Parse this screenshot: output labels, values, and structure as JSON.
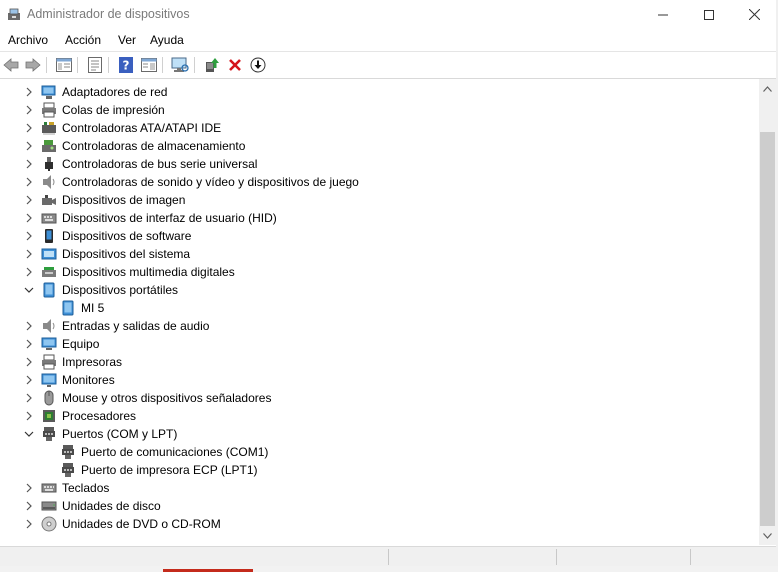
{
  "window": {
    "title": "Administrador de dispositivos"
  },
  "menu": [
    "Archivo",
    "Acción",
    "Ver",
    "Ayuda"
  ],
  "toolbar_icons": [
    "back-arrow-icon",
    "forward-arrow-icon",
    "show-hide-tree-icon",
    "properties-icon",
    "help-icon",
    "action-pane-icon",
    "scan-hardware-icon",
    "update-driver-icon",
    "uninstall-icon",
    "disable-icon"
  ],
  "tree": [
    {
      "label": "Adaptadores de red",
      "expanded": false,
      "icon": "network-adapter-icon"
    },
    {
      "label": "Colas de impresión",
      "expanded": false,
      "icon": "print-queue-icon"
    },
    {
      "label": "Controladoras ATA/ATAPI IDE",
      "expanded": false,
      "icon": "ide-controller-icon"
    },
    {
      "label": "Controladoras de almacenamiento",
      "expanded": false,
      "icon": "storage-controller-icon"
    },
    {
      "label": "Controladoras de bus serie universal",
      "expanded": false,
      "icon": "usb-icon"
    },
    {
      "label": "Controladoras de sonido y vídeo y dispositivos de juego",
      "expanded": false,
      "icon": "speaker-icon"
    },
    {
      "label": "Dispositivos de imagen",
      "expanded": false,
      "icon": "camera-icon"
    },
    {
      "label": "Dispositivos de interfaz de usuario (HID)",
      "expanded": false,
      "icon": "hid-keyboard-icon"
    },
    {
      "label": "Dispositivos de software",
      "expanded": false,
      "icon": "software-device-icon"
    },
    {
      "label": "Dispositivos del sistema",
      "expanded": false,
      "icon": "system-device-icon"
    },
    {
      "label": "Dispositivos multimedia digitales",
      "expanded": false,
      "icon": "multimedia-device-icon"
    },
    {
      "label": "Dispositivos portátiles",
      "expanded": true,
      "icon": "portable-device-icon",
      "children": [
        {
          "label": "MI 5",
          "icon": "phone-icon"
        }
      ]
    },
    {
      "label": "Entradas y salidas de audio",
      "expanded": false,
      "icon": "audio-io-icon"
    },
    {
      "label": "Equipo",
      "expanded": false,
      "icon": "computer-icon"
    },
    {
      "label": "Impresoras",
      "expanded": false,
      "icon": "printer-icon"
    },
    {
      "label": "Monitores",
      "expanded": false,
      "icon": "monitor-icon"
    },
    {
      "label": "Mouse y otros dispositivos señaladores",
      "expanded": false,
      "icon": "mouse-icon"
    },
    {
      "label": "Procesadores",
      "expanded": false,
      "icon": "processor-icon"
    },
    {
      "label": "Puertos (COM y LPT)",
      "expanded": true,
      "icon": "port-icon",
      "children": [
        {
          "label": "Puerto de comunicaciones (COM1)",
          "icon": "port-icon"
        },
        {
          "label": "Puerto de impresora ECP (LPT1)",
          "icon": "port-icon"
        }
      ]
    },
    {
      "label": "Teclados",
      "expanded": false,
      "icon": "keyboard-icon"
    },
    {
      "label": "Unidades de disco",
      "expanded": false,
      "icon": "disk-drive-icon"
    },
    {
      "label": "Unidades de DVD o CD-ROM",
      "expanded": false,
      "icon": "dvd-drive-icon"
    }
  ],
  "colors": {
    "accent": "#0078d7",
    "title_text": "#7a7a7a",
    "uninstall_red": "#d4131b",
    "update_green": "#2e9e3e"
  }
}
